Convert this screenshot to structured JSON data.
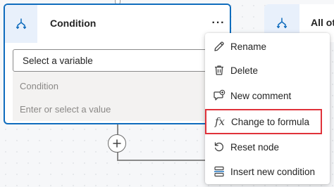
{
  "node": {
    "title": "Condition",
    "more_label": "···",
    "variable_select": {
      "value": "Select a variable"
    },
    "condition_label": "Condition",
    "value_placeholder": "Enter or select a value"
  },
  "other_node": {
    "title": "All ot"
  },
  "add_button": {
    "label": "+"
  },
  "menu": {
    "items": [
      {
        "label": "Rename",
        "icon": "pencil-icon"
      },
      {
        "label": "Delete",
        "icon": "trash-icon"
      },
      {
        "label": "New comment",
        "icon": "comment-add-icon"
      },
      {
        "label": "Change to formula",
        "icon": "fx-icon",
        "highlighted": true
      },
      {
        "label": "Reset node",
        "icon": "reset-icon"
      },
      {
        "label": "Insert new condition",
        "icon": "insert-condition-icon"
      }
    ]
  },
  "colors": {
    "accent": "#0f6cbd",
    "highlight_border": "#e0323a",
    "icon_bg": "#e8f0fb"
  }
}
